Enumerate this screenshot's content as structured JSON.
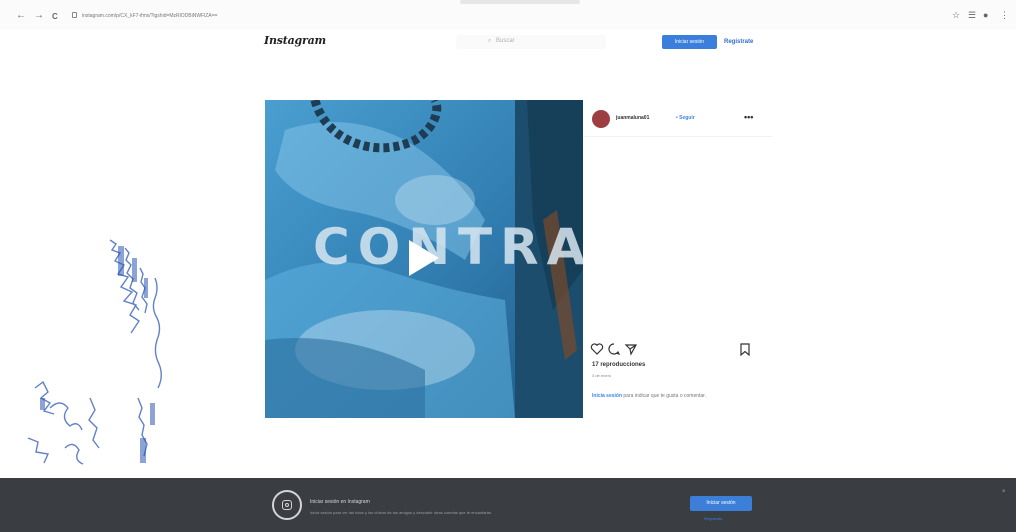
{
  "browser": {
    "back": "←",
    "forward": "→",
    "reload": "C",
    "url": "instagram.com/p/CX_kF7-ifmx/?igshid=MzRlODBiNWFlZA==",
    "right_icons": [
      "☆",
      "☰",
      "●",
      "⋮"
    ]
  },
  "header": {
    "logo": "Instagram",
    "search_placeholder": "Buscar",
    "search_icon": "search-icon",
    "login_label": "Iniciar sesión",
    "signup_label": "Regístrate"
  },
  "post": {
    "overlay_text": "CONTRA",
    "username": "juanmaluna01",
    "follow": "• Seguir",
    "more": "•••",
    "reproductions": "17 reproducciones",
    "date": "3 de enero",
    "login_link": "Inicia sesión",
    "login_rest": " para indicar que te gusta o comentar."
  },
  "banner": {
    "title": "Iniciar sesión en Instagram",
    "subtitle": "Inicia sesión para ver las fotos y los vídeos de tus amigos y descubrir otras cuentas que te encantarán.",
    "login_label": "Iniciar sesión",
    "signup_label": "Regístrate",
    "close": "×"
  },
  "colors": {
    "accent": "#3a7fdc",
    "banner_bg": "#3a3d42",
    "avatar": "#9c3e42"
  }
}
